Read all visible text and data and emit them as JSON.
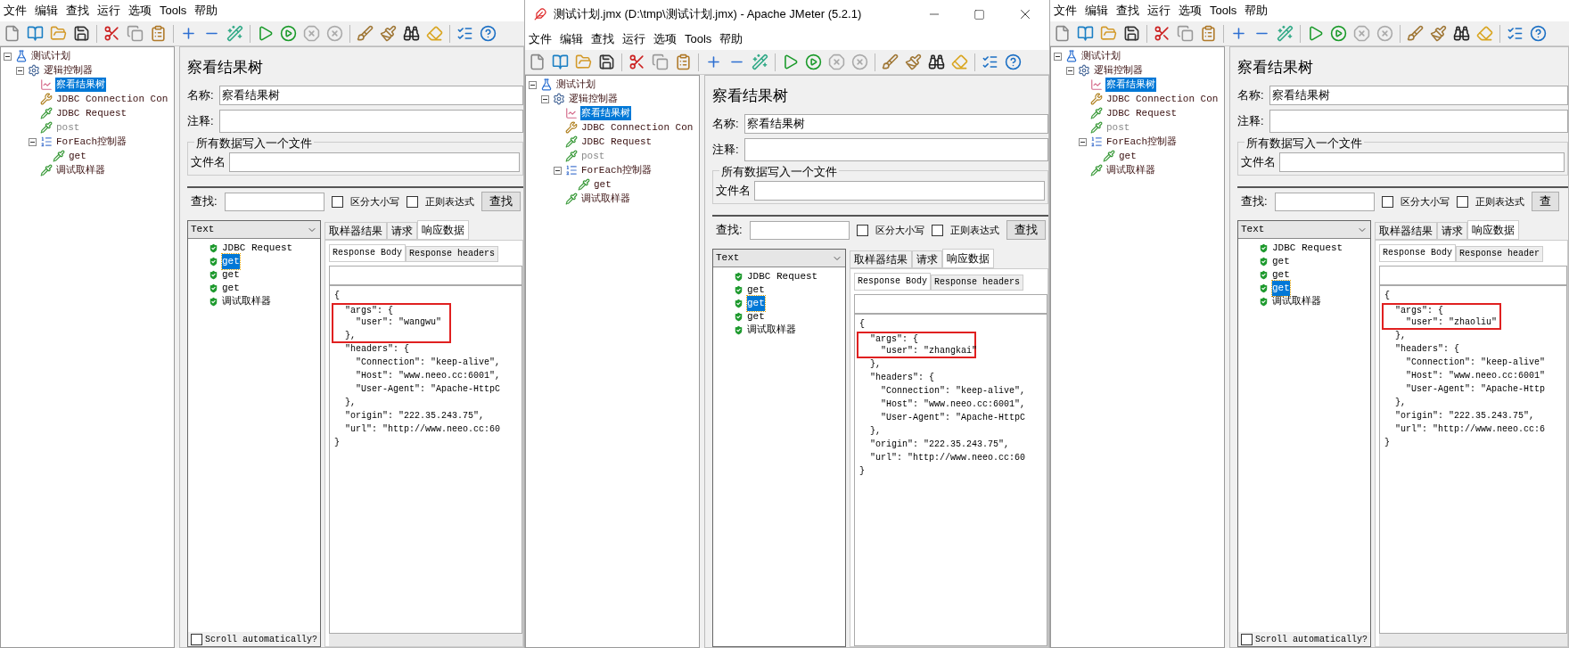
{
  "windows": [
    {
      "menu": [
        "文件",
        "编辑",
        "查找",
        "运行",
        "选项",
        "Tools",
        "帮助"
      ],
      "tree": [
        {
          "label": "测试计划",
          "kind": "plan",
          "selected": false,
          "disabled": false,
          "expanded": true,
          "children": [
            {
              "label": "逻辑控制器",
              "kind": "controller",
              "selected": false,
              "disabled": false,
              "expanded": true,
              "children": [
                {
                  "label": "察看结果树",
                  "kind": "listener",
                  "selected": true,
                  "disabled": false
                },
                {
                  "label": "JDBC Connection Con",
                  "kind": "config",
                  "selected": false,
                  "disabled": false
                },
                {
                  "label": "JDBC Request",
                  "kind": "sampler",
                  "selected": false,
                  "disabled": false
                },
                {
                  "label": "post",
                  "kind": "sampler",
                  "selected": false,
                  "disabled": true
                },
                {
                  "label": "ForEach控制器",
                  "kind": "foreach",
                  "selected": false,
                  "disabled": false,
                  "expanded": true,
                  "children": [
                    {
                      "label": "get",
                      "kind": "sampler",
                      "selected": false,
                      "disabled": false
                    }
                  ]
                },
                {
                  "label": "调试取样器",
                  "kind": "sampler",
                  "selected": false,
                  "disabled": false
                }
              ]
            }
          ]
        }
      ],
      "panel": {
        "heading": "察看结果树",
        "name_label": "名称:",
        "name_value": "察看结果树",
        "comment_label": "注释:",
        "file_group": "所有数据写入一个文件",
        "file_label": "文件名",
        "search_label": "查找:",
        "case_label": "区分大小写",
        "case_checked": false,
        "regex_label": "正则表达式",
        "regex_checked": false,
        "search_button": "查找"
      },
      "renderer": "Text",
      "results": [
        {
          "label": "JDBC Request",
          "selected": false
        },
        {
          "label": "get",
          "selected": true
        },
        {
          "label": "get",
          "selected": false
        },
        {
          "label": "get",
          "selected": false
        },
        {
          "label": "调试取样器",
          "selected": false
        }
      ],
      "tabs": [
        {
          "label": "取样器结果",
          "selected": false
        },
        {
          "label": "请求",
          "selected": false
        },
        {
          "label": "响应数据",
          "selected": true
        }
      ],
      "subtabs": [
        {
          "label": "Response Body",
          "selected": true
        },
        {
          "label": "Response headers",
          "selected": false
        }
      ],
      "body": [
        {
          "text": "{",
          "boxed": false
        },
        {
          "text": "  \"args\": {",
          "boxed": true
        },
        {
          "text": "    \"user\": \"wangwu\"",
          "boxed": true
        },
        {
          "text": "  },",
          "boxed": true
        },
        {
          "text": "  \"headers\": {",
          "boxed": false
        },
        {
          "text": "    \"Connection\": \"keep-alive\",",
          "boxed": false
        },
        {
          "text": "    \"Host\": \"www.neeo.cc:6001\",",
          "boxed": false
        },
        {
          "text": "    \"User-Agent\": \"Apache-HttpC",
          "boxed": false
        },
        {
          "text": "  },",
          "boxed": false
        },
        {
          "text": "  \"origin\": \"222.35.243.75\",",
          "boxed": false
        },
        {
          "text": "  \"url\": \"http://www.neeo.cc:60",
          "boxed": false
        },
        {
          "text": "}",
          "boxed": false
        }
      ],
      "scroll": {
        "label": "Scroll automatically?",
        "checked": false
      }
    },
    {
      "title": "测试计划.jmx (D:\\tmp\\测试计划.jmx) - Apache JMeter (5.2.1)",
      "menu": [
        "文件",
        "编辑",
        "查找",
        "运行",
        "选项",
        "Tools",
        "帮助"
      ],
      "tree": [
        {
          "label": "测试计划",
          "kind": "plan",
          "selected": false,
          "disabled": false,
          "expanded": true,
          "children": [
            {
              "label": "逻辑控制器",
              "kind": "controller",
              "selected": false,
              "disabled": false,
              "expanded": true,
              "children": [
                {
                  "label": "察看结果树",
                  "kind": "listener",
                  "selected": true,
                  "disabled": false
                },
                {
                  "label": "JDBC Connection Con",
                  "kind": "config",
                  "selected": false,
                  "disabled": false
                },
                {
                  "label": "JDBC Request",
                  "kind": "sampler",
                  "selected": false,
                  "disabled": false
                },
                {
                  "label": "post",
                  "kind": "sampler",
                  "selected": false,
                  "disabled": true
                },
                {
                  "label": "ForEach控制器",
                  "kind": "foreach",
                  "selected": false,
                  "disabled": false,
                  "expanded": true,
                  "children": [
                    {
                      "label": "get",
                      "kind": "sampler",
                      "selected": false,
                      "disabled": false
                    }
                  ]
                },
                {
                  "label": "调试取样器",
                  "kind": "sampler",
                  "selected": false,
                  "disabled": false
                }
              ]
            }
          ]
        }
      ],
      "panel": {
        "heading": "察看结果树",
        "name_label": "名称:",
        "name_value": "察看结果树",
        "comment_label": "注释:",
        "file_group": "所有数据写入一个文件",
        "file_label": "文件名",
        "search_label": "查找:",
        "case_label": "区分大小写",
        "case_checked": false,
        "regex_label": "正则表达式",
        "regex_checked": false,
        "search_button": "查找"
      },
      "renderer": "Text",
      "results": [
        {
          "label": "JDBC Request",
          "selected": false
        },
        {
          "label": "get",
          "selected": false
        },
        {
          "label": "get",
          "selected": true
        },
        {
          "label": "get",
          "selected": false
        },
        {
          "label": "调试取样器",
          "selected": false
        }
      ],
      "tabs": [
        {
          "label": "取样器结果",
          "selected": false
        },
        {
          "label": "请求",
          "selected": false
        },
        {
          "label": "响应数据",
          "selected": true
        }
      ],
      "subtabs": [
        {
          "label": "Response Body",
          "selected": true
        },
        {
          "label": "Response headers",
          "selected": false
        }
      ],
      "body": [
        {
          "text": "{",
          "boxed": false
        },
        {
          "text": "  \"args\": {",
          "boxed": true
        },
        {
          "text": "    \"user\": \"zhangkai\"",
          "boxed": true
        },
        {
          "text": "  },",
          "boxed": false
        },
        {
          "text": "  \"headers\": {",
          "boxed": false
        },
        {
          "text": "    \"Connection\": \"keep-alive\",",
          "boxed": false
        },
        {
          "text": "    \"Host\": \"www.neeo.cc:6001\",",
          "boxed": false
        },
        {
          "text": "    \"User-Agent\": \"Apache-HttpC",
          "boxed": false
        },
        {
          "text": "  },",
          "boxed": false
        },
        {
          "text": "  \"origin\": \"222.35.243.75\",",
          "boxed": false
        },
        {
          "text": "  \"url\": \"http://www.neeo.cc:60",
          "boxed": false
        },
        {
          "text": "}",
          "boxed": false
        }
      ]
    },
    {
      "menu": [
        "文件",
        "编辑",
        "查找",
        "运行",
        "选项",
        "Tools",
        "帮助"
      ],
      "tree": [
        {
          "label": "测试计划",
          "kind": "plan",
          "selected": false,
          "disabled": false,
          "expanded": true,
          "children": [
            {
              "label": "逻辑控制器",
              "kind": "controller",
              "selected": false,
              "disabled": false,
              "expanded": true,
              "children": [
                {
                  "label": "察看结果树",
                  "kind": "listener",
                  "selected": true,
                  "disabled": false
                },
                {
                  "label": "JDBC Connection Con",
                  "kind": "config",
                  "selected": false,
                  "disabled": false
                },
                {
                  "label": "JDBC Request",
                  "kind": "sampler",
                  "selected": false,
                  "disabled": false
                },
                {
                  "label": "post",
                  "kind": "sampler",
                  "selected": false,
                  "disabled": true
                },
                {
                  "label": "ForEach控制器",
                  "kind": "foreach",
                  "selected": false,
                  "disabled": false,
                  "expanded": true,
                  "children": [
                    {
                      "label": "get",
                      "kind": "sampler",
                      "selected": false,
                      "disabled": false
                    }
                  ]
                },
                {
                  "label": "调试取样器",
                  "kind": "sampler",
                  "selected": false,
                  "disabled": false
                }
              ]
            }
          ]
        }
      ],
      "panel": {
        "heading": "察看结果树",
        "name_label": "名称:",
        "name_value": "察看结果树",
        "comment_label": "注释:",
        "file_group": "所有数据写入一个文件",
        "file_label": "文件名",
        "search_label": "查找:",
        "case_label": "区分大小写",
        "case_checked": false,
        "regex_label": "正则表达式",
        "regex_checked": false,
        "search_button": "查"
      },
      "renderer": "Text",
      "results": [
        {
          "label": "JDBC Request",
          "selected": false
        },
        {
          "label": "get",
          "selected": false
        },
        {
          "label": "get",
          "selected": false
        },
        {
          "label": "get",
          "selected": true
        },
        {
          "label": "调试取样器",
          "selected": false
        }
      ],
      "tabs": [
        {
          "label": "取样器结果",
          "selected": false
        },
        {
          "label": "请求",
          "selected": false
        },
        {
          "label": "响应数据",
          "selected": true
        }
      ],
      "subtabs": [
        {
          "label": "Response Body",
          "selected": true
        },
        {
          "label": "Response header",
          "selected": false
        }
      ],
      "body": [
        {
          "text": "{",
          "boxed": false
        },
        {
          "text": "  \"args\": {",
          "boxed": true
        },
        {
          "text": "    \"user\": \"zhaoliu\"",
          "boxed": true
        },
        {
          "text": "  },",
          "boxed": false
        },
        {
          "text": "  \"headers\": {",
          "boxed": false
        },
        {
          "text": "    \"Connection\": \"keep-alive\"",
          "boxed": false
        },
        {
          "text": "    \"Host\": \"www.neeo.cc:6001\"",
          "boxed": false
        },
        {
          "text": "    \"User-Agent\": \"Apache-Http",
          "boxed": false
        },
        {
          "text": "  },",
          "boxed": false
        },
        {
          "text": "  \"origin\": \"222.35.243.75\",",
          "boxed": false
        },
        {
          "text": "  \"url\": \"http://www.neeo.cc:6",
          "boxed": false
        },
        {
          "text": "}",
          "boxed": false
        }
      ],
      "scroll": {
        "label": "Scroll automatically?",
        "checked": false
      }
    }
  ]
}
